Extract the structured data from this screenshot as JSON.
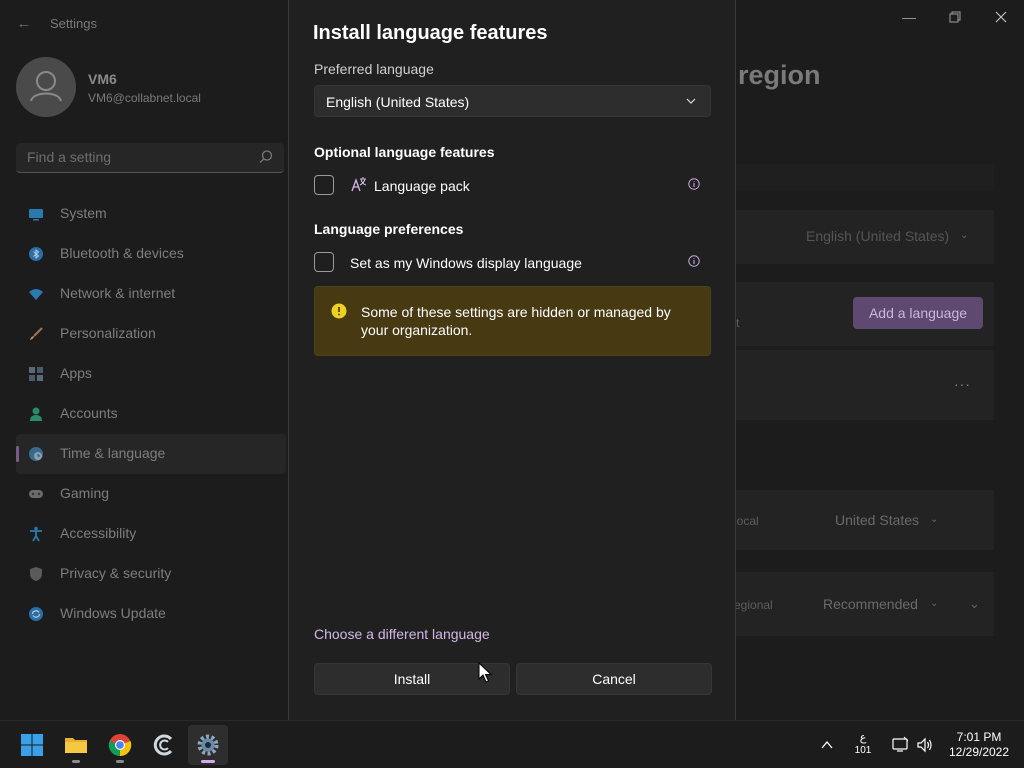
{
  "settings_window": {
    "title": "Settings",
    "controls": [
      "minimize",
      "maximize",
      "close"
    ],
    "profile": {
      "name": "VM6",
      "email": "VM6@collabnet.local"
    },
    "search": {
      "placeholder": "Find a setting"
    },
    "nav_items": [
      {
        "label": "System",
        "icon": "system-icon",
        "color": "#3a9bd9"
      },
      {
        "label": "Bluetooth & devices",
        "icon": "bluetooth-icon",
        "color": "#3a9bd9"
      },
      {
        "label": "Network & internet",
        "icon": "wifi-icon",
        "color": "#3a9bd9"
      },
      {
        "label": "Personalization",
        "icon": "brush-icon",
        "color": "#d08a5a"
      },
      {
        "label": "Apps",
        "icon": "apps-icon",
        "color": "#8a9bb0"
      },
      {
        "label": "Accounts",
        "icon": "accounts-icon",
        "color": "#3aa88a"
      },
      {
        "label": "Time & language",
        "icon": "globe-clock-icon",
        "color": "#3a9bd9",
        "selected": true
      },
      {
        "label": "Gaming",
        "icon": "gamepad-icon",
        "color": "#8a8a8a"
      },
      {
        "label": "Accessibility",
        "icon": "accessibility-icon",
        "color": "#3a9bd9"
      },
      {
        "label": "Privacy & security",
        "icon": "shield-icon",
        "color": "#8a8a8a"
      },
      {
        "label": "Windows Update",
        "icon": "update-icon",
        "color": "#3a9bd9"
      }
    ],
    "page_heading_fragment": "region",
    "background_content": {
      "fragment_s": "s",
      "windows_display_language": "English (United States)",
      "fragment_st": "st",
      "add_language_button": "Add a language",
      "more_options": "···",
      "fragment_local": "local",
      "country_region": "United States",
      "fragment_regional": "egional",
      "regional_format": "Recommended"
    }
  },
  "dialog": {
    "title": "Install language features",
    "preferred_language_label": "Preferred language",
    "preferred_language_value": "English (United States)",
    "optional_features_heading": "Optional language features",
    "language_pack_label": "Language pack",
    "language_pack_checked": false,
    "language_preferences_heading": "Language preferences",
    "display_language_label": "Set as my Windows display language",
    "display_language_checked": false,
    "warning_banner": "Some of these settings are hidden or managed by your organization.",
    "choose_different_link": "Choose a different language",
    "install_button": "Install",
    "cancel_button": "Cancel"
  },
  "taskbar": {
    "apps": [
      {
        "name": "Start",
        "icon": "windows-start-icon"
      },
      {
        "name": "File Explorer",
        "icon": "folder-icon",
        "running": true
      },
      {
        "name": "Google Chrome",
        "icon": "chrome-icon",
        "running": true
      },
      {
        "name": "CCleaner",
        "icon": "ccleaner-icon",
        "running": false
      },
      {
        "name": "Settings",
        "icon": "settings-gear-icon",
        "running": true,
        "active": true
      }
    ],
    "language_indicator": {
      "line1": "ع",
      "line2": "101"
    },
    "clock": {
      "time": "7:01 PM",
      "date": "12/29/2022"
    }
  },
  "colors": {
    "accent_purple": "#d4b8e6",
    "warning_banner_bg": "#473a13",
    "warning_icon": "#f0d020",
    "dialog_bg": "#202020"
  }
}
